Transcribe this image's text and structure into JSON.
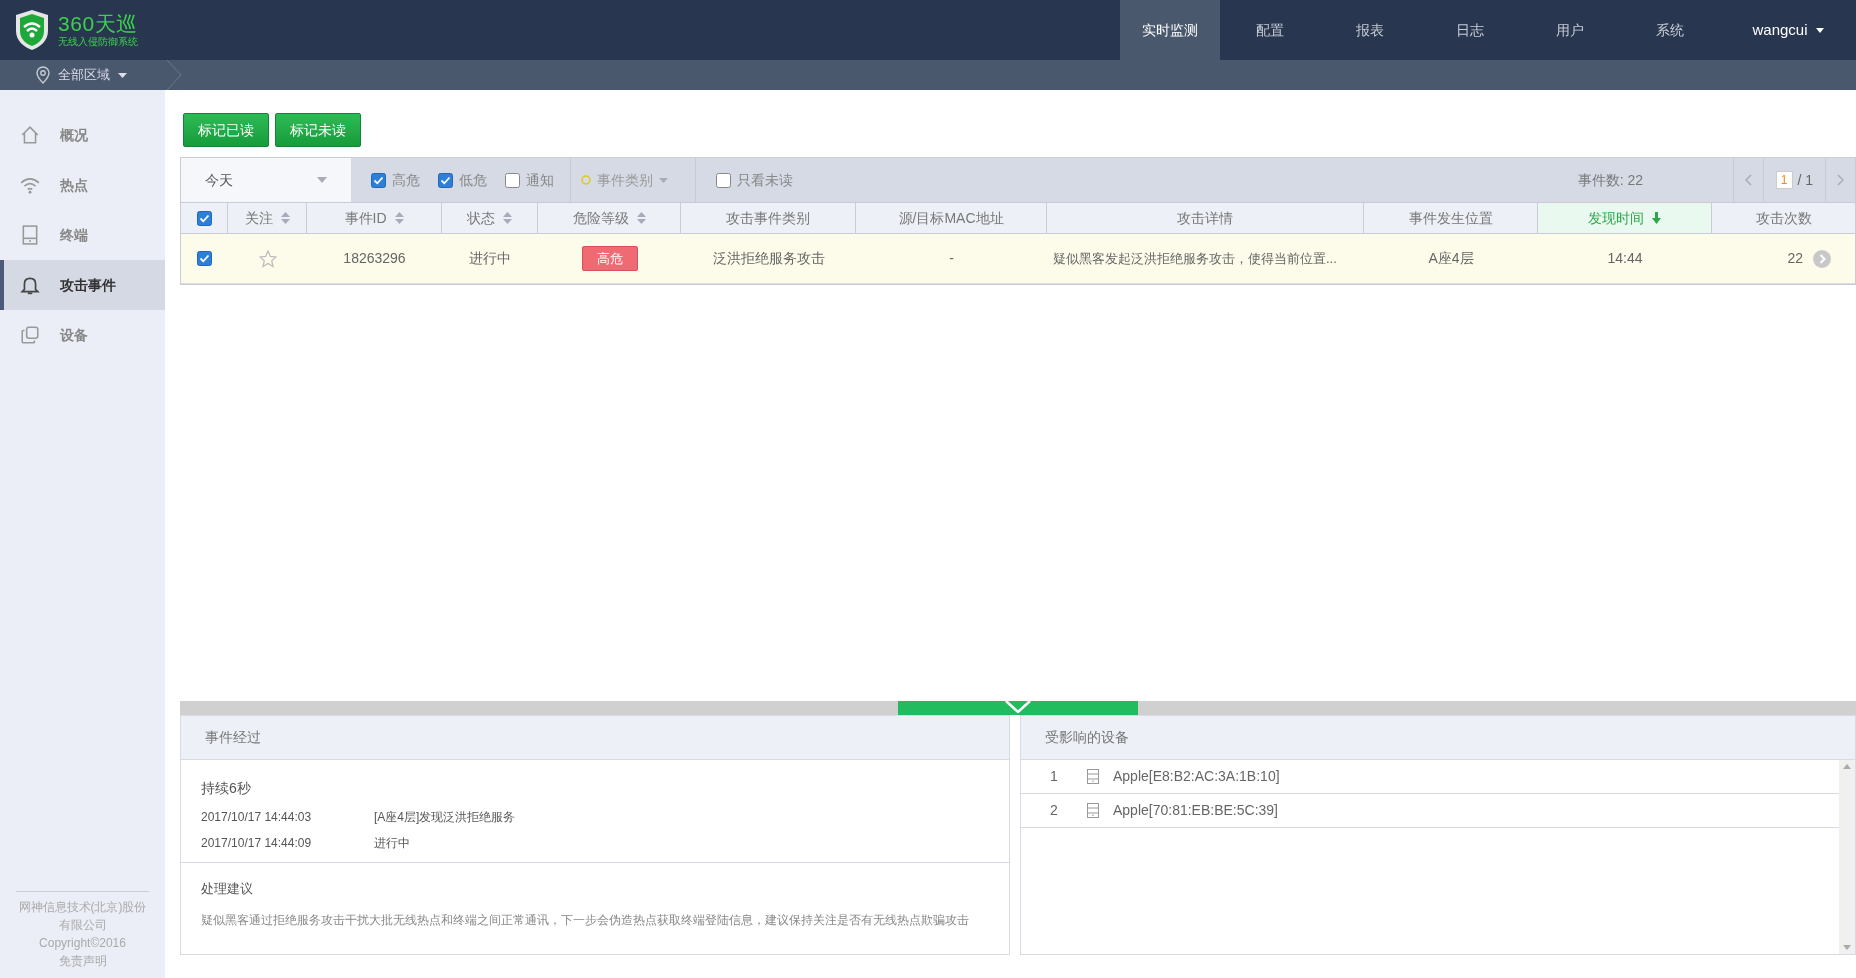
{
  "logo": {
    "title": "360天巡",
    "subtitle": "无线入侵防御系统"
  },
  "nav": [
    {
      "label": "实时监测",
      "selected": true
    },
    {
      "label": "配置",
      "selected": false
    },
    {
      "label": "报表",
      "selected": false
    },
    {
      "label": "日志",
      "selected": false
    },
    {
      "label": "用户",
      "selected": false
    },
    {
      "label": "系统",
      "selected": false
    }
  ],
  "user": "wangcui",
  "region": "全部区域",
  "sidebar": {
    "items": [
      {
        "label": "概况",
        "selected": false
      },
      {
        "label": "热点",
        "selected": false
      },
      {
        "label": "终端",
        "selected": false
      },
      {
        "label": "攻击事件",
        "selected": true
      },
      {
        "label": "设备",
        "selected": false
      }
    ],
    "footer": [
      "网神信息技术(北京)股份有限公司",
      "Copyright©2016",
      "免责声明"
    ]
  },
  "actions": [
    "标记已读",
    "标记未读"
  ],
  "filters": {
    "date": "今天",
    "levels": [
      {
        "label": "高危",
        "checked": true
      },
      {
        "label": "低危",
        "checked": true
      },
      {
        "label": "通知",
        "checked": false
      }
    ],
    "category": "事件类别",
    "unread_only": {
      "label": "只看未读",
      "checked": false
    },
    "count": "事件数: 22",
    "page": "1",
    "pages": "/ 1"
  },
  "table": {
    "all_checked": true,
    "columns": [
      {
        "label": "关注",
        "kind": "sortable"
      },
      {
        "label": "事件ID",
        "kind": "sortable"
      },
      {
        "label": "状态",
        "kind": "sortable"
      },
      {
        "label": "危险等级",
        "kind": "sortable"
      },
      {
        "label": "攻击事件类别",
        "kind": "plain"
      },
      {
        "label": "源/目标MAC地址",
        "kind": "plain"
      },
      {
        "label": "攻击详情",
        "kind": "plain"
      },
      {
        "label": "事件发生位置",
        "kind": "plain"
      },
      {
        "label": "发现时间",
        "kind": "sorted"
      },
      {
        "label": "攻击次数",
        "kind": "plain"
      }
    ],
    "rows": [
      {
        "checked": true,
        "followed": false,
        "id": "18263296",
        "status": "进行中",
        "level": "高危",
        "category": "泛洪拒绝服务攻击",
        "mac": "-",
        "detail": "疑似黑客发起泛洪拒绝服务攻击，使得当前位置...",
        "location": "A座4层",
        "time": "14:44",
        "count": "22",
        "selected": true
      }
    ]
  },
  "history": {
    "title": "事件经过",
    "duration": "持续6秒",
    "entries": [
      {
        "time": "2017/10/17 14:44:03",
        "text": "[A座4层]发现泛洪拒绝服务"
      },
      {
        "time": "2017/10/17 14:44:09",
        "text": "进行中"
      }
    ],
    "advice_title": "处理建议",
    "advice": "疑似黑客通过拒绝服务攻击干扰大批无线热点和终端之间正常通讯，下一步会伪造热点获取终端登陆信息，建议保持关注是否有无线热点欺骗攻击"
  },
  "devices": {
    "title": "受影响的设备",
    "items": [
      {
        "index": "1",
        "name": "Apple[E8:B2:AC:3A:1B:10]"
      },
      {
        "index": "2",
        "name": "Apple[70:81:EB:BE:5C:39]"
      }
    ]
  }
}
